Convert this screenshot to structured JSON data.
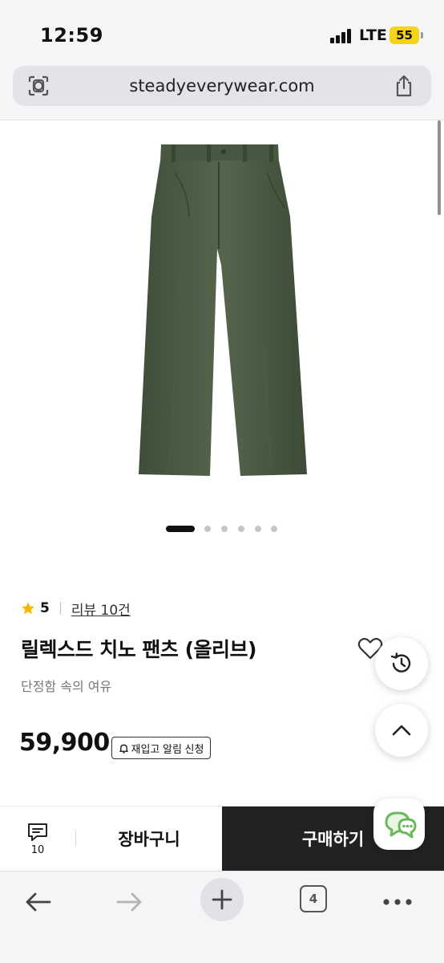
{
  "status_bar": {
    "time": "12:59",
    "network": "LTE",
    "battery": "55"
  },
  "browser": {
    "url": "steadyeverywear.com",
    "tab_count": "4"
  },
  "product": {
    "rating": "5",
    "review_label": "리뷰 10건",
    "title": "릴렉스드 치노 팬츠 (올리브)",
    "subtitle": "단정함 속의 여유",
    "price": "59,900",
    "restock_label": "재입고 알림 신청",
    "image_color": "#4a5a43",
    "carousel_total": 6,
    "carousel_active": 0
  },
  "bottom_bar": {
    "comment_count": "10",
    "cart_label": "장바구니",
    "buy_label": "구매하기"
  },
  "colors": {
    "accent_star": "#f5b800",
    "chat_green": "#7bc26b",
    "buy_bg": "#222222"
  },
  "icons": [
    "lens-icon",
    "share-icon",
    "star-icon",
    "heart-icon",
    "share-icon",
    "history-icon",
    "chevron-up-icon",
    "chat-icon",
    "comment-icon",
    "bell-icon",
    "back-arrow-icon",
    "forward-arrow-icon",
    "plus-icon",
    "tabs-icon",
    "more-icon"
  ]
}
